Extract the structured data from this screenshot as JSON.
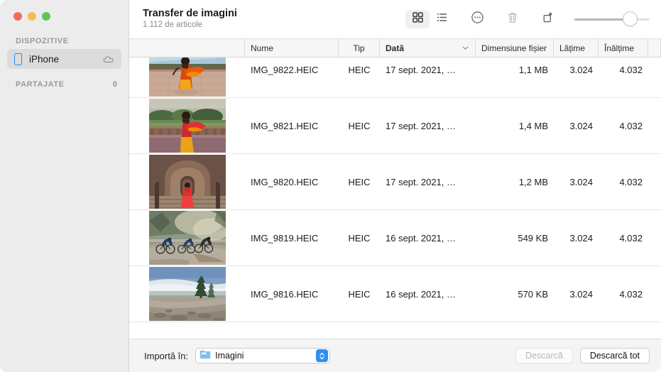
{
  "window": {
    "traffic_lights": [
      "close",
      "minimize",
      "zoom"
    ],
    "colors": {
      "red": "#ed6a5e",
      "yellow": "#f5bd4f",
      "green": "#61c554",
      "accent": "#2f8ef4",
      "device_icon": "#1f8bff"
    }
  },
  "sidebar": {
    "sections": [
      {
        "label": "DISPOZITIVE"
      },
      {
        "label": "PARTAJATE",
        "count": "0"
      }
    ],
    "devices": [
      {
        "label": "iPhone",
        "selected": true,
        "icon": "iphone-icon",
        "trailing_icon": "cloud-icon"
      }
    ]
  },
  "toolbar": {
    "title": "Transfer de imagini",
    "subtitle": "1.112 de articole",
    "buttons": [
      {
        "name": "grid-view",
        "icon": "grid-icon",
        "active": true
      },
      {
        "name": "list-view",
        "icon": "list-icon",
        "active": false
      },
      {
        "name": "more-options",
        "icon": "ellipsis-circle-icon",
        "active": false
      },
      {
        "name": "delete",
        "icon": "trash-icon",
        "active": false,
        "disabled": true
      },
      {
        "name": "rotate",
        "icon": "rotate-icon",
        "active": false
      }
    ],
    "zoom_slider": {
      "name": "thumbnail-size-slider",
      "value": 80
    }
  },
  "table": {
    "columns": [
      {
        "key": "thumb",
        "label": ""
      },
      {
        "key": "name",
        "label": "Nume"
      },
      {
        "key": "tip",
        "label": "Tip"
      },
      {
        "key": "data",
        "label": "Dată",
        "sorted": true,
        "sort_direction": "descending"
      },
      {
        "key": "size",
        "label": "Dimensiune fișier"
      },
      {
        "key": "width",
        "label": "Lățime"
      },
      {
        "key": "height",
        "label": "Înălțime"
      }
    ],
    "rows": [
      {
        "name": "IMG_9822.HEIC",
        "tip": "HEIC",
        "data": "17 sept. 2021, …",
        "size": "1,1 MB",
        "width": "3.024",
        "height": "4.032",
        "thumb": "woman-red-sari-terrace"
      },
      {
        "name": "IMG_9821.HEIC",
        "tip": "HEIC",
        "data": "17 sept. 2021, …",
        "size": "1,4 MB",
        "width": "3.024",
        "height": "4.032",
        "thumb": "woman-red-sari-garden"
      },
      {
        "name": "IMG_9820.HEIC",
        "tip": "HEIC",
        "data": "17 sept. 2021, …",
        "size": "1,2 MB",
        "width": "3.024",
        "height": "4.032",
        "thumb": "woman-red-sari-stairs"
      },
      {
        "name": "IMG_9819.HEIC",
        "tip": "HEIC",
        "data": "16 sept. 2021, …",
        "size": "549 KB",
        "width": "3.024",
        "height": "4.032",
        "thumb": "cyclists-misty-road"
      },
      {
        "name": "IMG_9816.HEIC",
        "tip": "HEIC",
        "data": "16 sept. 2021, …",
        "size": "570 KB",
        "width": "3.024",
        "height": "4.032",
        "thumb": "mountain-pine-above-clouds"
      }
    ]
  },
  "bottom_bar": {
    "import_label": "Importă în:",
    "destination": {
      "value": "Imagini",
      "icon": "pictures-folder-icon"
    },
    "download_button": {
      "label": "Descarcă",
      "disabled": true
    },
    "download_all_button": {
      "label": "Descarcă tot",
      "disabled": false
    }
  }
}
